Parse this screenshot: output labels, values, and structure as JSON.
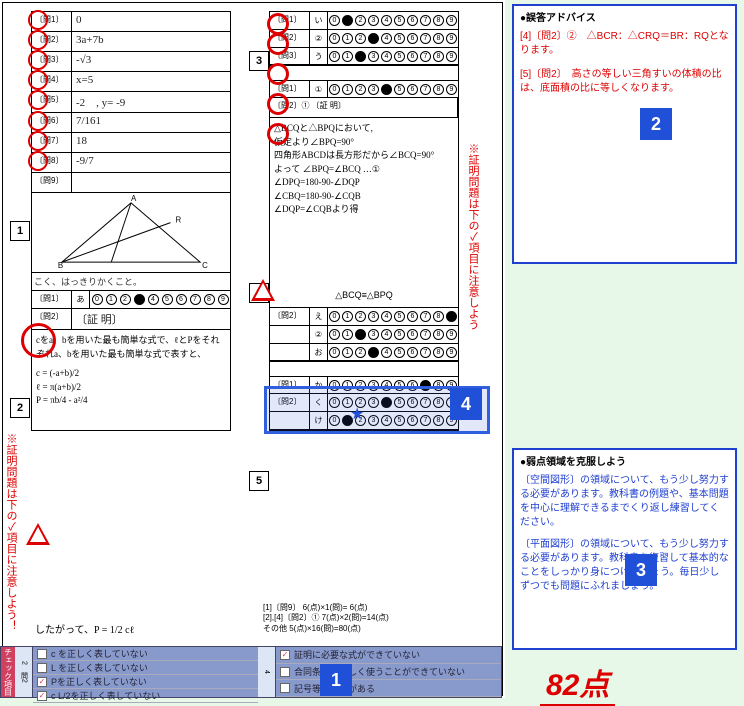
{
  "domain": "Document",
  "worksheet": {
    "leftCol": {
      "rows": [
        {
          "label": "〔問1〕",
          "val": "0",
          "mark": "circle"
        },
        {
          "label": "〔問2〕",
          "val": "3a+7b",
          "mark": "circle"
        },
        {
          "label": "〔問3〕",
          "val": "-√3",
          "mark": "circle"
        },
        {
          "label": "〔問4〕",
          "val": "x=5",
          "mark": "circle"
        },
        {
          "label": "〔問5〕",
          "val": "-2　, y= -9",
          "mark": "circle"
        },
        {
          "label": "〔問6〕",
          "val": "7/161",
          "mark": "circle"
        },
        {
          "label": "〔問7〕",
          "val": "18",
          "mark": "circle"
        },
        {
          "label": "〔問8〕",
          "val": "-9/7",
          "mark": "circle"
        },
        {
          "label": "〔問9〕",
          "val": "",
          "mark": ""
        }
      ],
      "scanNote": "こく、はっきりかくこと。",
      "sec2": {
        "row1": {
          "label": "〔問1〕",
          "sub": "あ"
        },
        "row2": {
          "label": "〔問2〕",
          "sub": "〔証 明〕"
        },
        "proof": "cをa、bを用いた最も簡単な式で、ℓとPをそれぞれa、bを用いた最も簡単な式で表すと、",
        "lines": [
          "c = (-a+b)/2",
          "ℓ = π(a+b)/2",
          "P = πb/4 - a²/4"
        ]
      }
    },
    "rightCol": {
      "sec3": [
        {
          "label": "〔問1〕",
          "sub": "い"
        },
        {
          "label": "〔問2〕",
          "sub": "②"
        },
        {
          "label": "〔問3〕",
          "sub": "う"
        }
      ],
      "sec4": {
        "row1": {
          "label": "〔問1〕"
        },
        "row2": {
          "label": "〔問2〕① 〔証 明〕"
        },
        "proof": "△BCQと△BPQにおいて,\n仮定より∠BPQ=90°\n四角形ABCDは長方形だから∠BCQ=90°\nよって ∠BPQ=∠BCQ …①\n∠DPQ=180-90-∠DQP\n∠CBQ=180-90-∠CQB\n∠DQP=∠CQBより得",
        "conclusion": "△BCQ≡△BPQ",
        "row3": [
          {
            "sub": "え"
          },
          {
            "sub": "②"
          },
          {
            "sub": "お"
          }
        ]
      },
      "sec5": [
        {
          "label": "〔問1〕",
          "sub": "か"
        },
        {
          "label": "〔問2〕",
          "sub": "く"
        },
        {
          "label": "",
          "sub": "け"
        }
      ]
    },
    "botEq": "したがって、P = 1/2 cℓ",
    "scoring": [
      "[1]〔問9〕 6(点)×1(問)= 6(点)",
      "[2],[4]〔問2〕① 7(点)×2(問)=14(点)",
      "その他 5(点)×16(問)=80(点)"
    ],
    "vtext1": "※証明問題は下の✓項目に注意しよう！",
    "vtext2": "※証明問題は下の✓項目に注意しよう"
  },
  "adviceTop": {
    "title": "●誤答アドバイス",
    "items": [
      "[4]〔問2〕②　△BCR：△CRQ＝BR：RQとなります。",
      "[5]〔問2〕　高さの等しい三角すいの体積の比は、底面積の比に等しくなります。"
    ]
  },
  "adviceBot": {
    "title": "●弱点領域を克服しよう",
    "items": [
      "〔空間図形〕の領域について、もう少し努力する必要があります。教科書の例題や、基本問題を中心に理解できるまでくり返し練習してください。",
      "〔平面図形〕の領域について、もう少し努力する必要があります。教科書を復習して基本的なことをしっかり身につけましょう。毎日少しずつでも問題にふれましょう。"
    ]
  },
  "score": "82点",
  "checklist": {
    "vlabel": "チェック項目",
    "sec1": "2　問2",
    "left": [
      {
        "ck": "",
        "txt": "c を正しく表していない"
      },
      {
        "ck": "",
        "txt": "L を正しく表していない"
      },
      {
        "ck": "✓",
        "txt": "Pを正しく表していない"
      },
      {
        "ck": "✓",
        "txt": "c L/2を正しく表していない"
      }
    ],
    "sec2": "4",
    "right": [
      {
        "ck": "✓",
        "txt": "証明に必要な式ができていない"
      },
      {
        "ck": "",
        "txt": "合同条件を正しく使うことができていない"
      },
      {
        "ck": "",
        "txt": "記号等にミスがある"
      }
    ]
  },
  "callouts": {
    "c1": "1",
    "c2": "2",
    "c3": "3",
    "c4": "4"
  }
}
